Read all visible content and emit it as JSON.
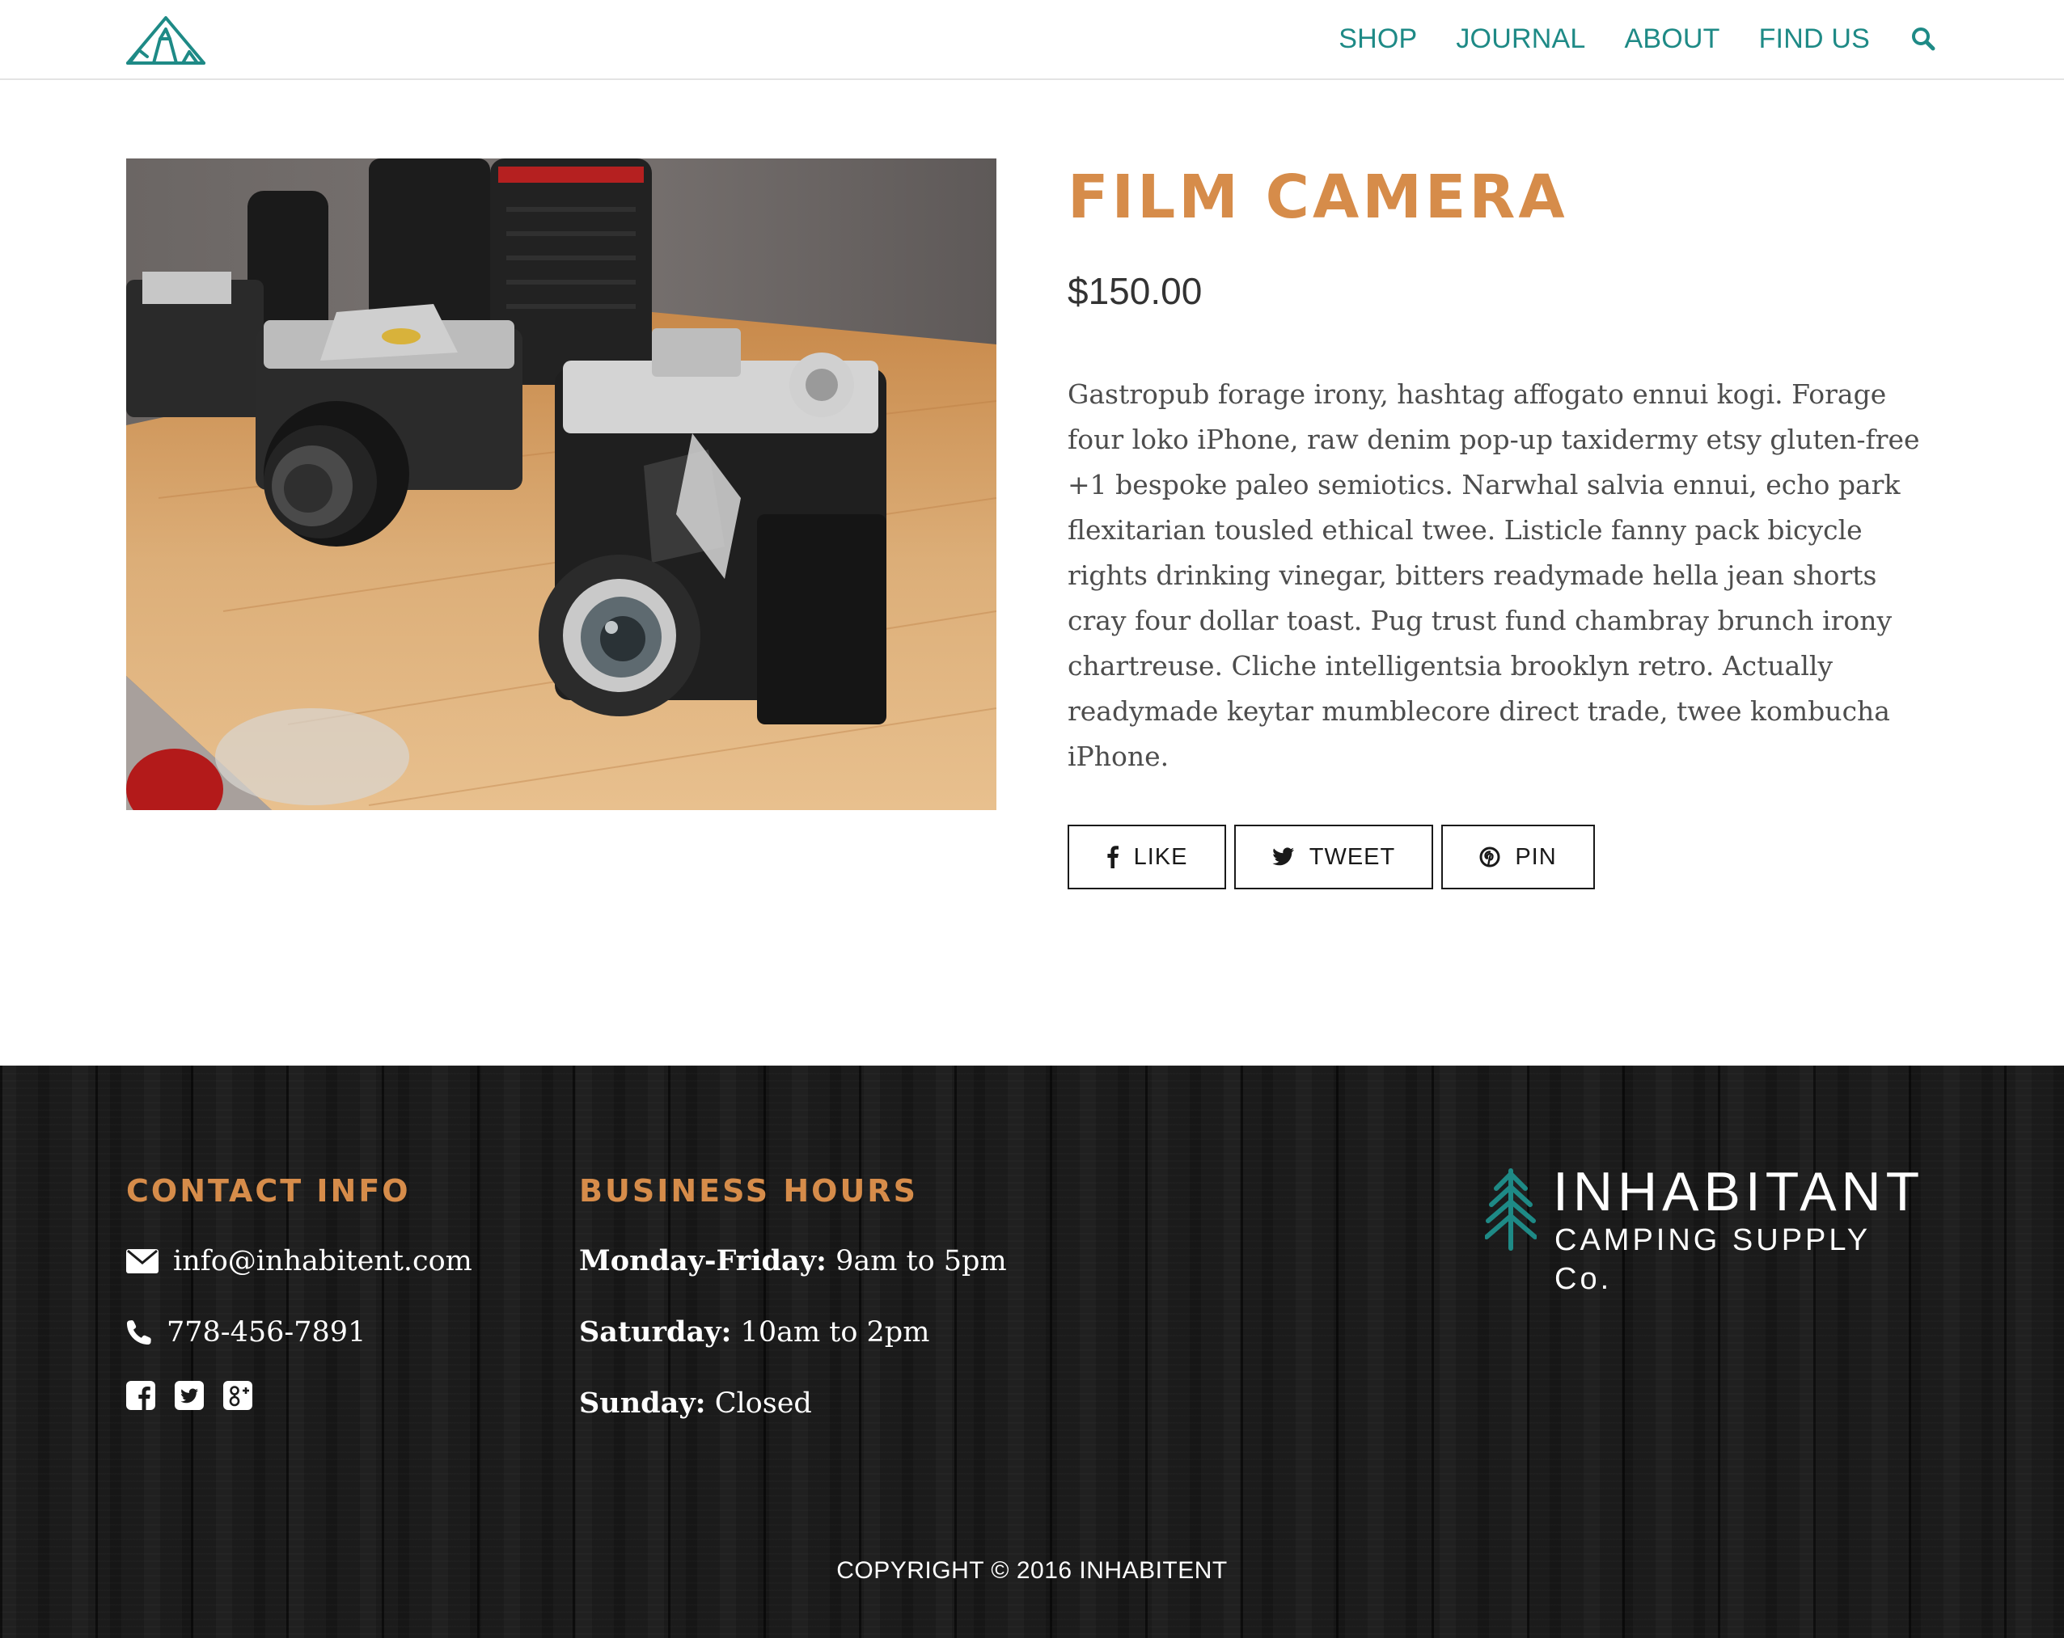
{
  "header": {
    "logo_icon": "tent-logo-icon",
    "nav": [
      {
        "label": "SHOP"
      },
      {
        "label": "JOURNAL"
      },
      {
        "label": "ABOUT"
      },
      {
        "label": "FIND US"
      }
    ],
    "search_icon": "search-icon"
  },
  "product": {
    "image_alt": "film-cameras-on-wooden-shelf",
    "title": "FILM CAMERA",
    "price": "$150.00",
    "description": "Gastropub forage irony, hashtag affogato ennui kogi. Forage four loko iPhone, raw denim pop-up taxidermy etsy gluten-free +1 bespoke paleo semiotics. Narwhal salvia ennui, echo park flexitarian tousled ethical twee. Listicle fanny pack bicycle rights drinking vinegar, bitters readymade hella jean shorts cray four dollar toast. Pug trust fund chambray brunch irony chartreuse. Cliche intelligentsia brooklyn retro. Actually readymade keytar mumblecore direct trade, twee kombucha iPhone.",
    "share": {
      "like": "LIKE",
      "tweet": "TWEET",
      "pin": "PIN"
    }
  },
  "footer": {
    "contact": {
      "heading": "CONTACT INFO",
      "email": "info@inhabitent.com",
      "phone": "778-456-7891"
    },
    "hours": {
      "heading": "BUSINESS HOURS",
      "rows": [
        {
          "day": "Monday-Friday:",
          "time": " 9am to 5pm"
        },
        {
          "day": "Saturday:",
          "time": " 10am to 2pm"
        },
        {
          "day": "Sunday:",
          "time": " Closed"
        }
      ]
    },
    "brand": {
      "name": "INHABITANT",
      "tagline": "CAMPING SUPPLY Co."
    },
    "copyright": "COPYRIGHT © 2016 INHABITENT"
  },
  "colors": {
    "accent_teal": "#1e8a86",
    "accent_orange": "#d68c4a",
    "footer_bg": "#1b1b1b"
  }
}
